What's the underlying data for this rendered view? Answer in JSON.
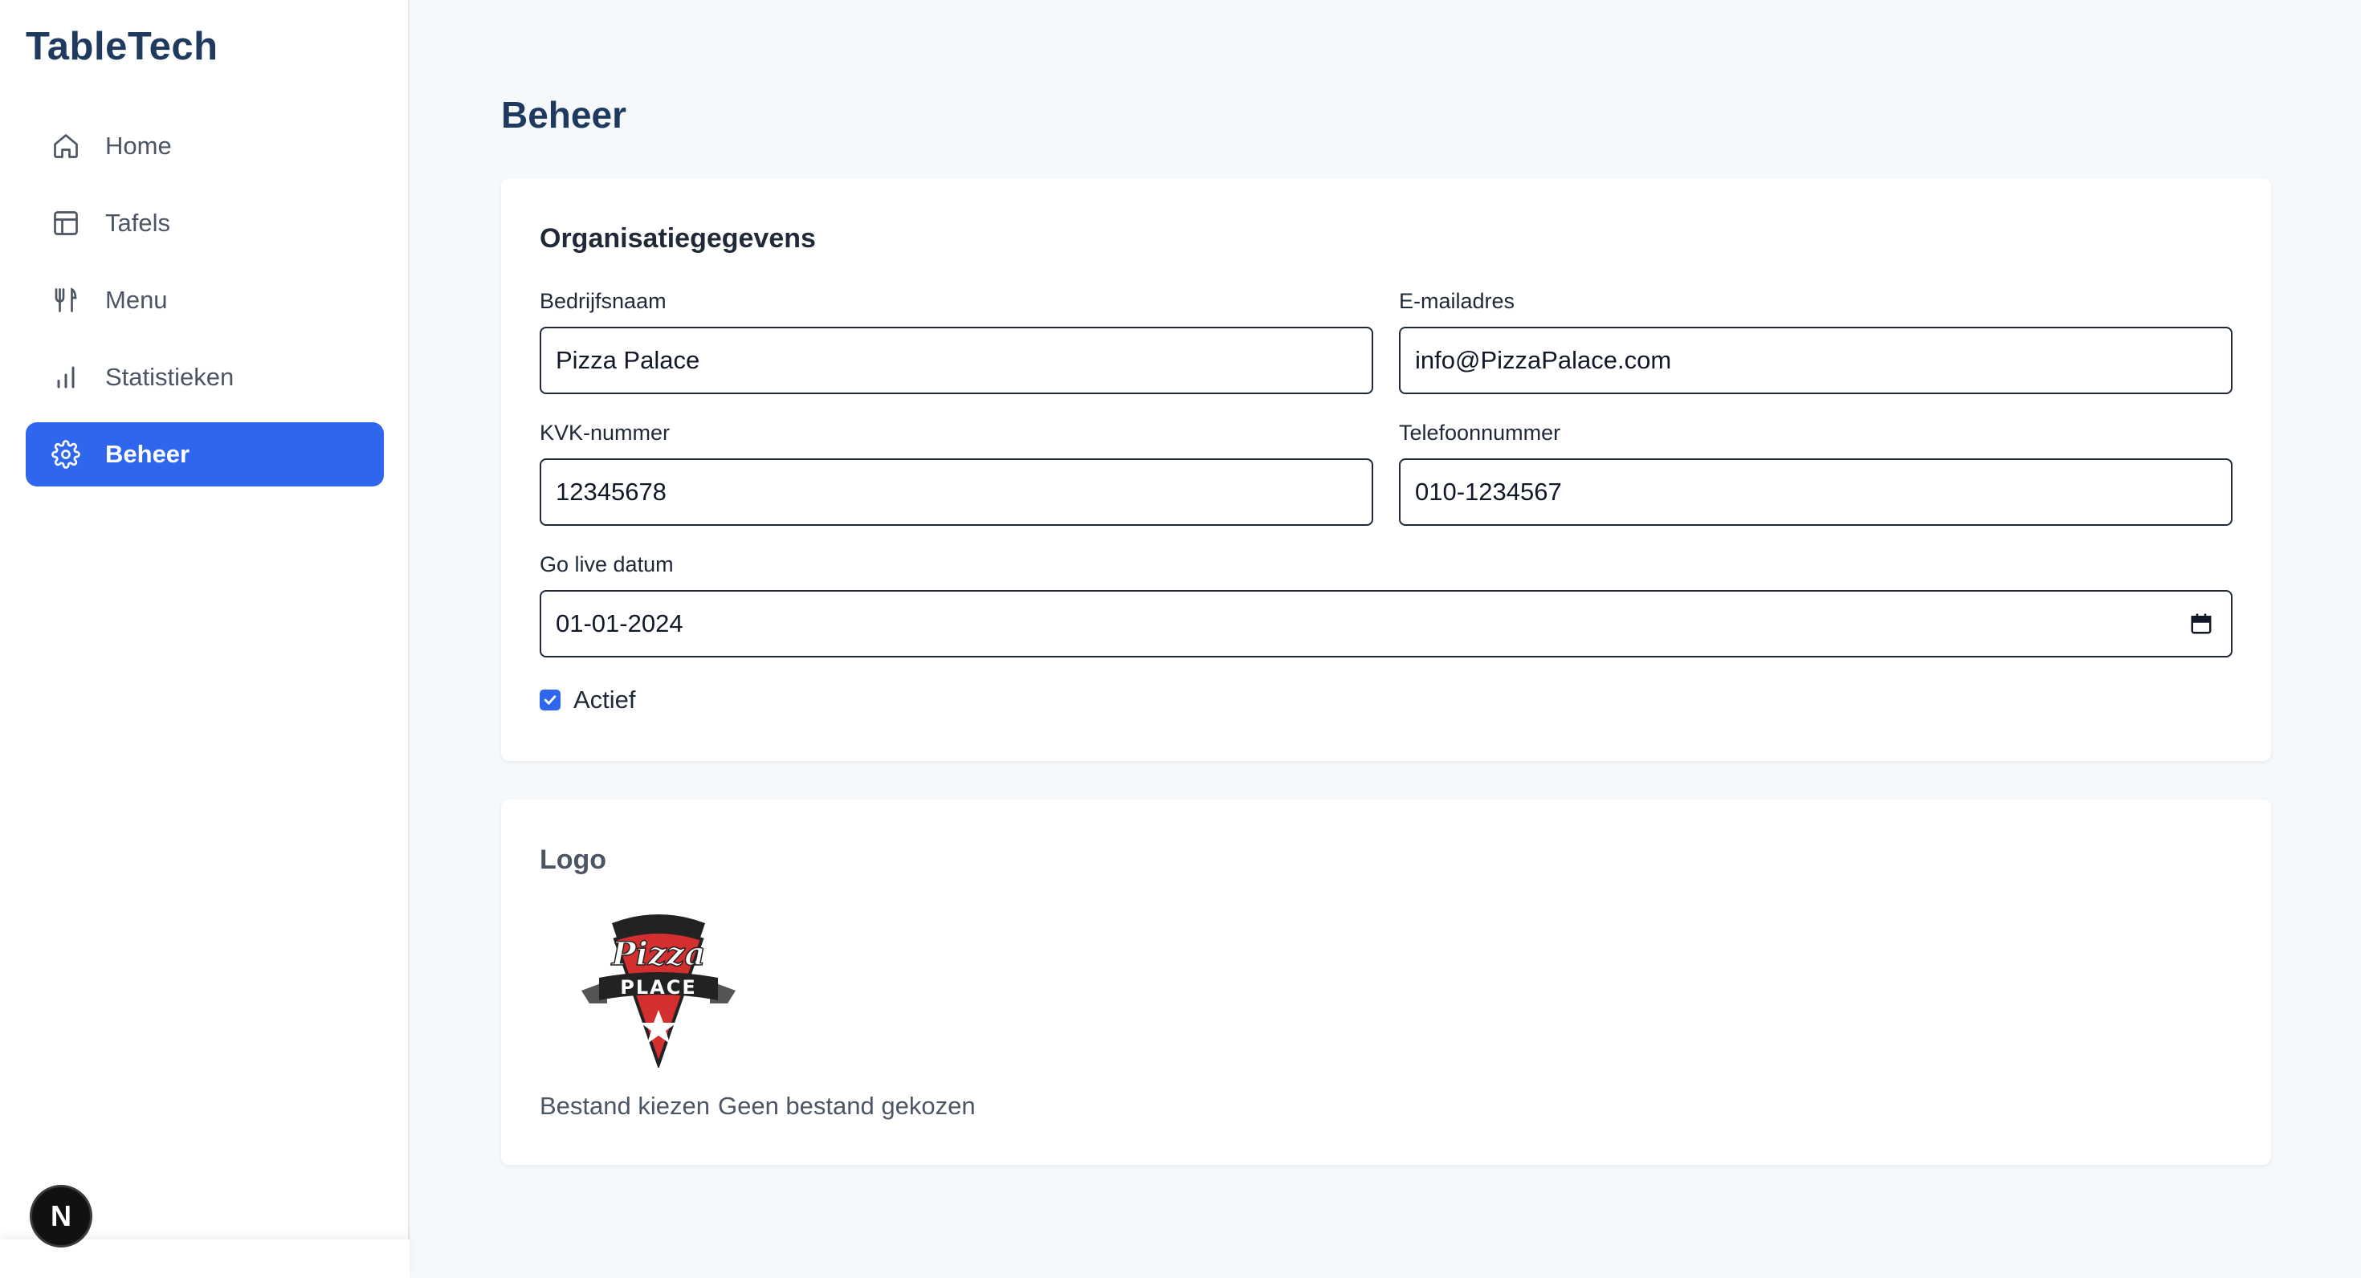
{
  "app": {
    "name": "TableTech"
  },
  "sidebar": {
    "items": [
      {
        "label": "Home",
        "icon": "home-icon",
        "active": false
      },
      {
        "label": "Tafels",
        "icon": "table-icon",
        "active": false
      },
      {
        "label": "Menu",
        "icon": "utensils-icon",
        "active": false
      },
      {
        "label": "Statistieken",
        "icon": "bar-chart-icon",
        "active": false
      },
      {
        "label": "Beheer",
        "icon": "gear-icon",
        "active": true
      }
    ],
    "badge": "N"
  },
  "page": {
    "title": "Beheer"
  },
  "organisation": {
    "title": "Organisatiegegevens",
    "company_name_label": "Bedrijfsnaam",
    "company_name_value": "Pizza Palace",
    "email_label": "E-mailadres",
    "email_value": "info@PizzaPalace.com",
    "kvk_label": "KVK-nummer",
    "kvk_value": "12345678",
    "phone_label": "Telefoonnummer",
    "phone_value": "010-1234567",
    "go_live_label": "Go live datum",
    "go_live_value": "01-01-2024",
    "active_label": "Actief",
    "active_checked": true
  },
  "logo": {
    "title": "Logo",
    "image_text_top": "Pizza",
    "image_text_banner": "PLACE",
    "choose_file_label": "Bestand kiezen",
    "no_file_label": "Geen bestand gekozen"
  },
  "colors": {
    "accent": "#2f66ee",
    "brand": "#1e3a5f",
    "logo_red": "#d32f2f"
  }
}
